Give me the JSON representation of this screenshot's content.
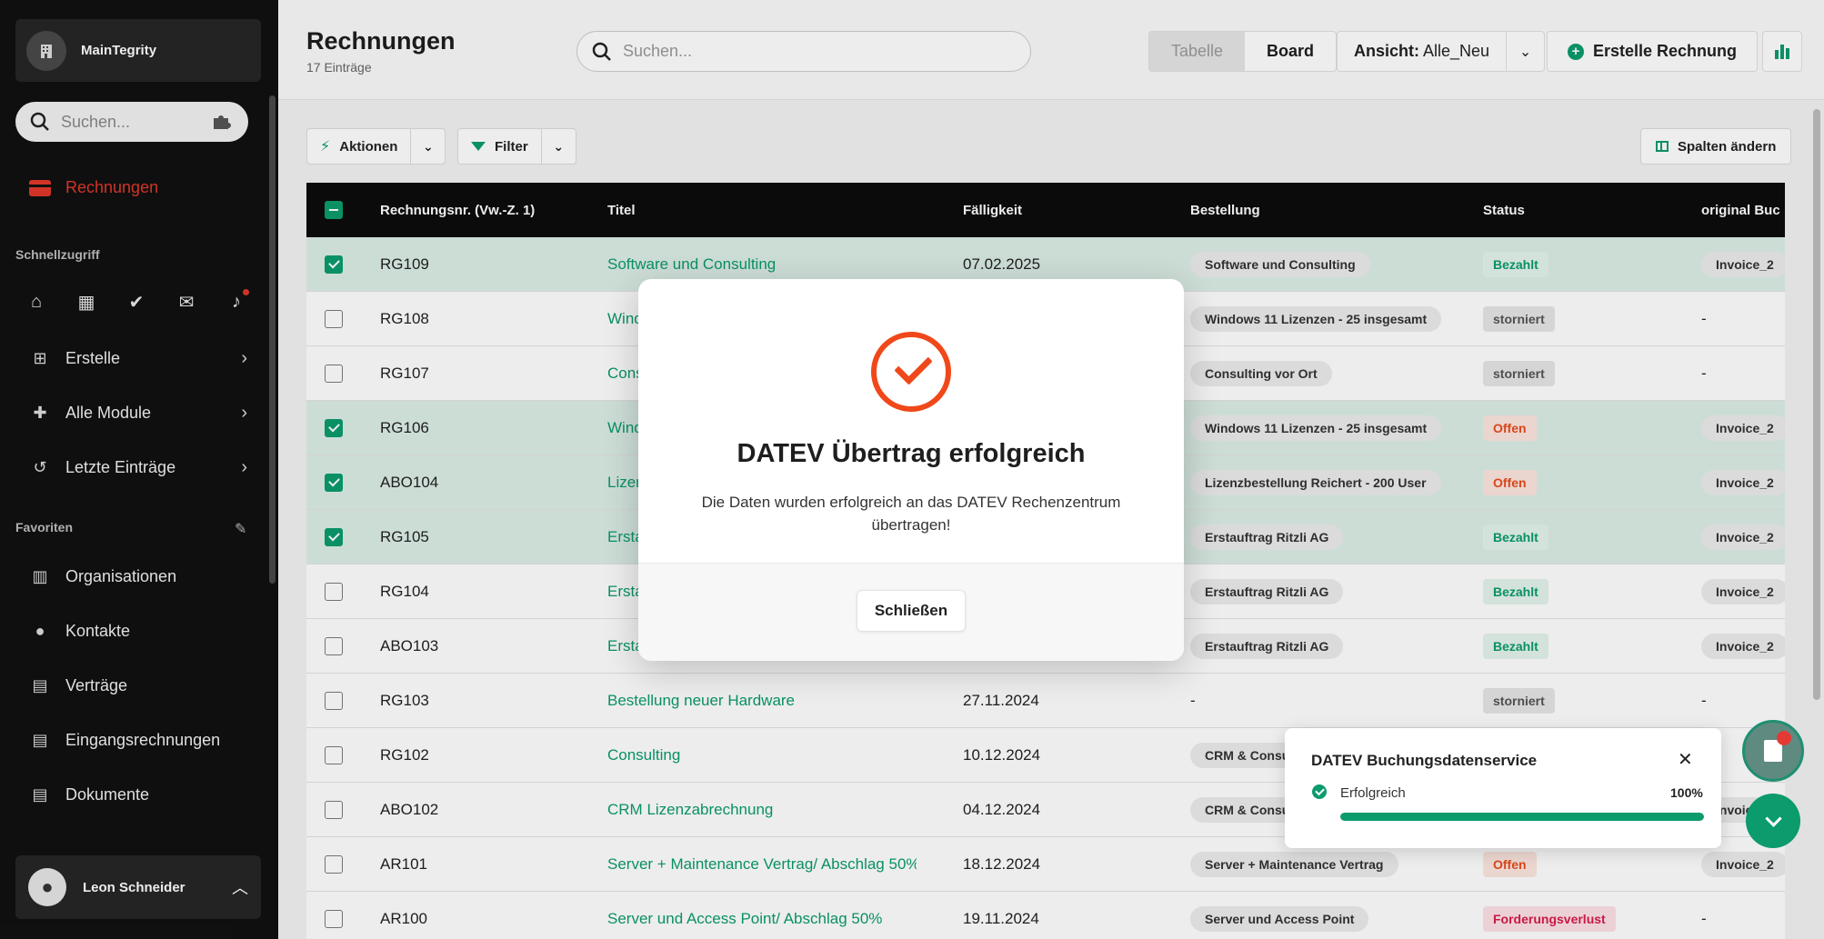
{
  "sidebar": {
    "org_name": "MainTegrity",
    "search_placeholder": "Suchen...",
    "active_item": "Rechnungen",
    "quick_label": "Schnellzugriff",
    "items": [
      {
        "label": "Erstelle",
        "icon": "plus-square-icon"
      },
      {
        "label": "Alle Module",
        "icon": "puzzle-icon"
      },
      {
        "label": "Letzte Einträge",
        "icon": "history-icon"
      }
    ],
    "favorites_label": "Favoriten",
    "favorites": [
      {
        "label": "Organisationen",
        "icon": "building-icon"
      },
      {
        "label": "Kontakte",
        "icon": "person-icon"
      },
      {
        "label": "Verträge",
        "icon": "contract-icon"
      },
      {
        "label": "Eingangsrechnungen",
        "icon": "document-icon"
      },
      {
        "label": "Dokumente",
        "icon": "file-icon"
      }
    ],
    "user_name": "Leon Schneider"
  },
  "header": {
    "title": "Rechnungen",
    "subtitle": "17 Einträge",
    "search_placeholder": "Suchen...",
    "view_table": "Tabelle",
    "view_board": "Board",
    "view_label": "Ansicht:",
    "view_value": "Alle_Neu",
    "create_label": "Erstelle Rechnung"
  },
  "toolbar": {
    "actions_label": "Aktionen",
    "filter_label": "Filter",
    "columns_label": "Spalten ändern"
  },
  "table": {
    "columns": [
      "Rechnungsnr. (Vw.-Z. 1)",
      "Titel",
      "Fälligkeit",
      "Bestellung",
      "Status",
      "original Buc"
    ],
    "rows": [
      {
        "selected": true,
        "nr": "RG109",
        "title": "Software und Consulting",
        "due": "07.02.2025",
        "order": "Software und Consulting",
        "status": "Bezahlt",
        "orig": "Invoice_2"
      },
      {
        "selected": false,
        "nr": "RG108",
        "title": "Windows 11 Lizenzen - 25 insgesamt",
        "due": "",
        "order": "Windows 11 Lizenzen - 25 insgesamt",
        "status": "storniert",
        "orig": "-"
      },
      {
        "selected": false,
        "nr": "RG107",
        "title": "Consulting vor Ort",
        "due": "",
        "order": "Consulting vor Ort",
        "status": "storniert",
        "orig": "-"
      },
      {
        "selected": true,
        "nr": "RG106",
        "title": "Windows 11 Lizenzen - 25 insgesamt",
        "due": "",
        "order": "Windows 11 Lizenzen - 25 insgesamt",
        "status": "Offen",
        "orig": "Invoice_2"
      },
      {
        "selected": true,
        "nr": "ABO104",
        "title": "Lizenzbestellung Reichert - 200 User",
        "due": "",
        "order": "Lizenzbestellung Reichert - 200 User",
        "status": "Offen",
        "orig": "Invoice_2"
      },
      {
        "selected": true,
        "nr": "RG105",
        "title": "Erstauftrag Ritzli AG",
        "due": "",
        "order": "Erstauftrag Ritzli AG",
        "status": "Bezahlt",
        "orig": "Invoice_2"
      },
      {
        "selected": false,
        "nr": "RG104",
        "title": "Erstauftrag Ritzli AG",
        "due": "",
        "order": "Erstauftrag Ritzli AG",
        "status": "Bezahlt",
        "orig": "Invoice_2"
      },
      {
        "selected": false,
        "nr": "ABO103",
        "title": "Erstauftrag Ritzli AG",
        "due": "",
        "order": "Erstauftrag Ritzli AG",
        "status": "Bezahlt",
        "orig": "Invoice_2"
      },
      {
        "selected": false,
        "nr": "RG103",
        "title": "Bestellung neuer Hardware",
        "due": "27.11.2024",
        "order": "-",
        "status": "storniert",
        "orig": "-"
      },
      {
        "selected": false,
        "nr": "RG102",
        "title": "Consulting",
        "due": "10.12.2024",
        "order": "CRM & Consulting",
        "status": "",
        "orig": ""
      },
      {
        "selected": false,
        "nr": "ABO102",
        "title": "CRM Lizenzabrechnung",
        "due": "04.12.2024",
        "order": "CRM & Consulting",
        "status": "",
        "orig": "Invoice_2"
      },
      {
        "selected": false,
        "nr": "AR101",
        "title": "Server + Maintenance Vertrag/ Abschlag 50%",
        "due": "18.12.2024",
        "order": "Server + Maintenance Vertrag",
        "status": "Offen",
        "orig": "Invoice_2"
      },
      {
        "selected": false,
        "nr": "AR100",
        "title": "Server und Access Point/ Abschlag 50%",
        "due": "19.11.2024",
        "order": "Server und Access Point",
        "status": "Forderungsverlust",
        "orig": "-"
      }
    ]
  },
  "modal": {
    "title": "DATEV Übertrag erfolgreich",
    "text": "Die Daten wurden erfolgreich an das DATEV Rechenzentrum übertragen!",
    "close_label": "Schließen"
  },
  "toast": {
    "title": "DATEV Buchungsdatenservice",
    "status": "Erfolgreich",
    "progress_label": "100%",
    "progress": 1.0
  },
  "colors": {
    "accent": "#0b9b6d",
    "danger": "#e0392b",
    "modal_icon": "#f0481a"
  }
}
